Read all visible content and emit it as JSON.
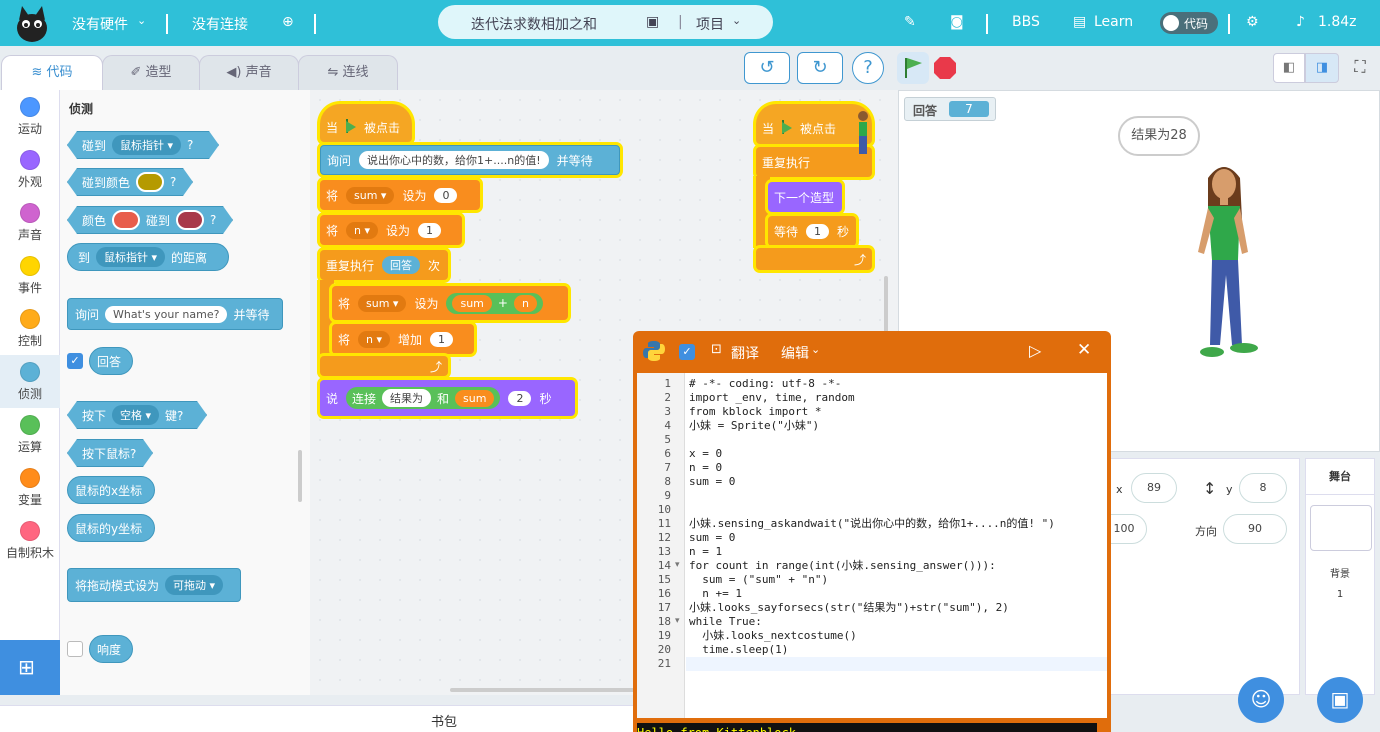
{
  "topbar": {
    "hardware": "没有硬件",
    "connection": "没有连接",
    "project_title": "迭代法求数相加之和",
    "project_menu": "项目",
    "bbs": "BBS",
    "learn": "Learn",
    "code_toggle": "代码",
    "version": "1.84z"
  },
  "tabs": [
    {
      "label": "代码"
    },
    {
      "label": "造型"
    },
    {
      "label": "声音"
    },
    {
      "label": "连线"
    }
  ],
  "categories": [
    {
      "label": "运动",
      "color": "#4c97ff"
    },
    {
      "label": "外观",
      "color": "#9966ff"
    },
    {
      "label": "声音",
      "color": "#cf63cf"
    },
    {
      "label": "事件",
      "color": "#ffd500"
    },
    {
      "label": "控制",
      "color": "#ffab19"
    },
    {
      "label": "侦测",
      "color": "#5cb1d6"
    },
    {
      "label": "运算",
      "color": "#59c059"
    },
    {
      "label": "变量",
      "color": "#ff8c1a"
    },
    {
      "label": "自制积木",
      "color": "#ff6680"
    }
  ],
  "palette": {
    "heading": "侦测",
    "touching": "碰到",
    "touching_target": "鼠标指针",
    "q": "?",
    "touching_color": "碰到颜色",
    "color1": "#b59a00",
    "color_touch": "颜色",
    "color_touch2": "碰到",
    "color2": "#e85c4a",
    "color3": "#a83a4a",
    "distance_to": "到",
    "distance_target": "鼠标指针",
    "distance_suffix": "的距离",
    "ask": "询问",
    "ask_default": "What's your name?",
    "ask_wait": "并等待",
    "answer": "回答",
    "key_pressed": "按下",
    "key": "空格",
    "key_suffix": "键?",
    "mouse_down": "按下鼠标?",
    "mouse_x": "鼠标的x坐标",
    "mouse_y": "鼠标的y坐标",
    "drag_mode": "将拖动模式设为",
    "drag_value": "可拖动",
    "loudness": "响度"
  },
  "script1": {
    "when": "当",
    "clicked": "被点击",
    "ask": "询问",
    "ask_text": "说出你心中的数，给你1+....n的值!",
    "ask_wait": "并等待",
    "set": "将",
    "var_sum": "sum",
    "set_to": "设为",
    "zero": "0",
    "var_n": "n",
    "one": "1",
    "repeat": "重复执行",
    "answer": "回答",
    "times": "次",
    "plus": "+",
    "n_reporter": "n",
    "change": "增加",
    "change_val": "1",
    "say": "说",
    "join": "连接",
    "join_a": "结果为",
    "join_and": "和",
    "join_b": "sum",
    "two": "2",
    "secs": "秒"
  },
  "script2": {
    "when": "当",
    "clicked": "被点击",
    "forever": "重复执行",
    "next_costume": "下一个造型",
    "wait": "等待",
    "wait_val": "1",
    "secs": "秒"
  },
  "stage": {
    "monitor_label": "回答",
    "monitor_value": "7",
    "speech": "结果为28"
  },
  "sprite": {
    "x_label": "x",
    "x": "89",
    "y_label": "y",
    "y": "8",
    "size": "100",
    "dir_label": "方向",
    "dir": "90"
  },
  "stage_panel": {
    "title": "舞台",
    "backdrop_label": "背景",
    "backdrop_count": "1"
  },
  "python": {
    "translate": "翻译",
    "edit": "编辑",
    "code": [
      "# -*- coding: utf-8 -*-",
      "import _env, time, random",
      "from kblock import *",
      "小妹 = Sprite(\"小妹\")",
      "",
      "x = 0",
      "n = 0",
      "sum = 0",
      "",
      "",
      "小妹.sensing_askandwait(\"说出你心中的数，给你1+....n的值! \")",
      "sum = 0",
      "n = 1",
      "for count in range(int(小妹.sensing_answer())):",
      "  sum = (\"sum\" + \"n\")",
      "  n += 1",
      "小妹.looks_sayforsecs(str(\"结果为\")+str(\"sum\"), 2)",
      "while True:",
      "  小妹.looks_nextcostume()",
      "  time.sleep(1)",
      ""
    ],
    "console": "Hello from Kittenblock"
  },
  "bottom": {
    "backpack": "书包"
  }
}
